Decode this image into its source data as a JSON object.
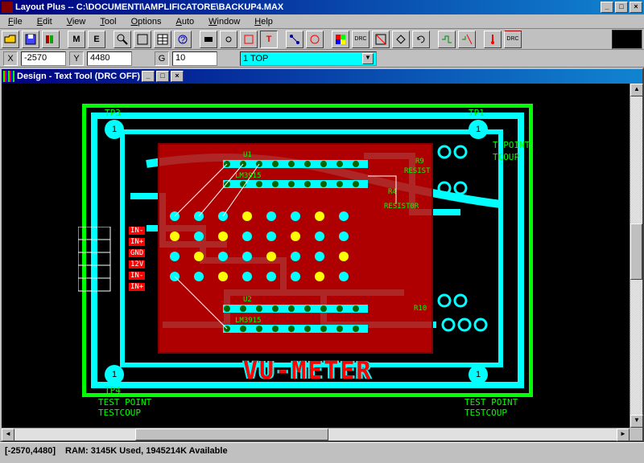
{
  "app": {
    "title": "Layout Plus -- C:\\DOCUMENTI\\AMPLIFICATORE\\BACKUP4.MAX"
  },
  "menu": {
    "file": "File",
    "edit": "Edit",
    "view": "View",
    "tool": "Tool",
    "options": "Options",
    "auto": "Auto",
    "window": "Window",
    "help": "Help"
  },
  "coords": {
    "xlabel": "X",
    "x": "-2570",
    "ylabel": "Y",
    "y": "4480",
    "glabel": "G",
    "g": "10"
  },
  "layer": {
    "selected": "1  TOP"
  },
  "doc": {
    "title": "Design - Text Tool (DRC OFF)"
  },
  "board": {
    "tp1": "1",
    "tp2": "1",
    "tp3": "1",
    "tp4": "1",
    "tp1_label": "TP1",
    "tp3_label": "TP3",
    "tp4_label": "TP4",
    "test_point": "TEST POINT",
    "test_coup": "TESTCOUP",
    "t_point": "T POINT",
    "tcoup": "TCOUP",
    "silkscreen_main": "VU-METER",
    "ic1": "LM3915",
    "ic2": "LM3915",
    "u1": "U1",
    "u2": "U2",
    "r_label1": "RESIST",
    "r_label2": "RESIST0R",
    "r4": "R4",
    "r9": "R9",
    "r10": "R10",
    "pins": [
      "IN-",
      "IN+",
      "GND",
      "12V",
      "IN-",
      "IN+"
    ]
  },
  "status": {
    "pos": "[-2570,4480]",
    "ram": "RAM: 3145K Used, 1945214K Available"
  }
}
